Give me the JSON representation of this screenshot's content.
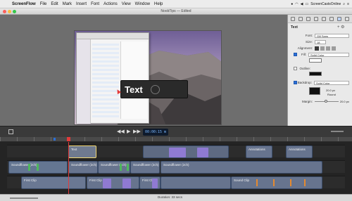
{
  "menubar": {
    "app_name": "ScreenFlow",
    "items": [
      "File",
      "Edit",
      "Mark",
      "Insert",
      "Font",
      "Actions",
      "View",
      "Window",
      "Help"
    ],
    "user": "ScreenCastsOnline"
  },
  "window": {
    "title": "NoobTips — Edited"
  },
  "canvas": {
    "text_box": "Text"
  },
  "inspector": {
    "section_title": "Text",
    "font_label": "Font:",
    "font_value": "Gill Sans",
    "size_label": "Size:",
    "size_value": "18",
    "alignment_label": "Alignment:",
    "fill_label": "Fill:",
    "fill_value": "Solid Color",
    "outline_label": "Outline:",
    "backdrop_label": "Backdrop:",
    "backdrop_value": "Solid Color",
    "round_value": "20.0 px",
    "round_label": "Round",
    "margin_label": "Margin:",
    "margin_value": "20.0 px"
  },
  "transport": {
    "timecode": "00:00:15 m"
  },
  "timeline": {
    "clips": {
      "text": "Text",
      "annotations_1": "Annotations",
      "annotations_2": "Annotations",
      "track2_first": "Soundflower (2ch)",
      "track2_soundflower_1": "Soundflower (2ch)",
      "track2_soundflower_2": "Soundflower (2ch)",
      "track2_soundflower_3": "Soundflower (2ch)",
      "track2_soundflower_4": "Soundflower (2ch)",
      "track3_first": "First Clip",
      "track3_first_2": "First Clip",
      "track3_first_3": "First Clip",
      "track3_sound": "Sound Clip"
    }
  },
  "status": {
    "duration": "Duration: 33 secs"
  },
  "colors": {
    "accent_blue": "#2b6fd6",
    "clip_purple": "#8f7ad2",
    "clip_green": "#4fb85d",
    "playhead_red": "#e23b3b"
  }
}
